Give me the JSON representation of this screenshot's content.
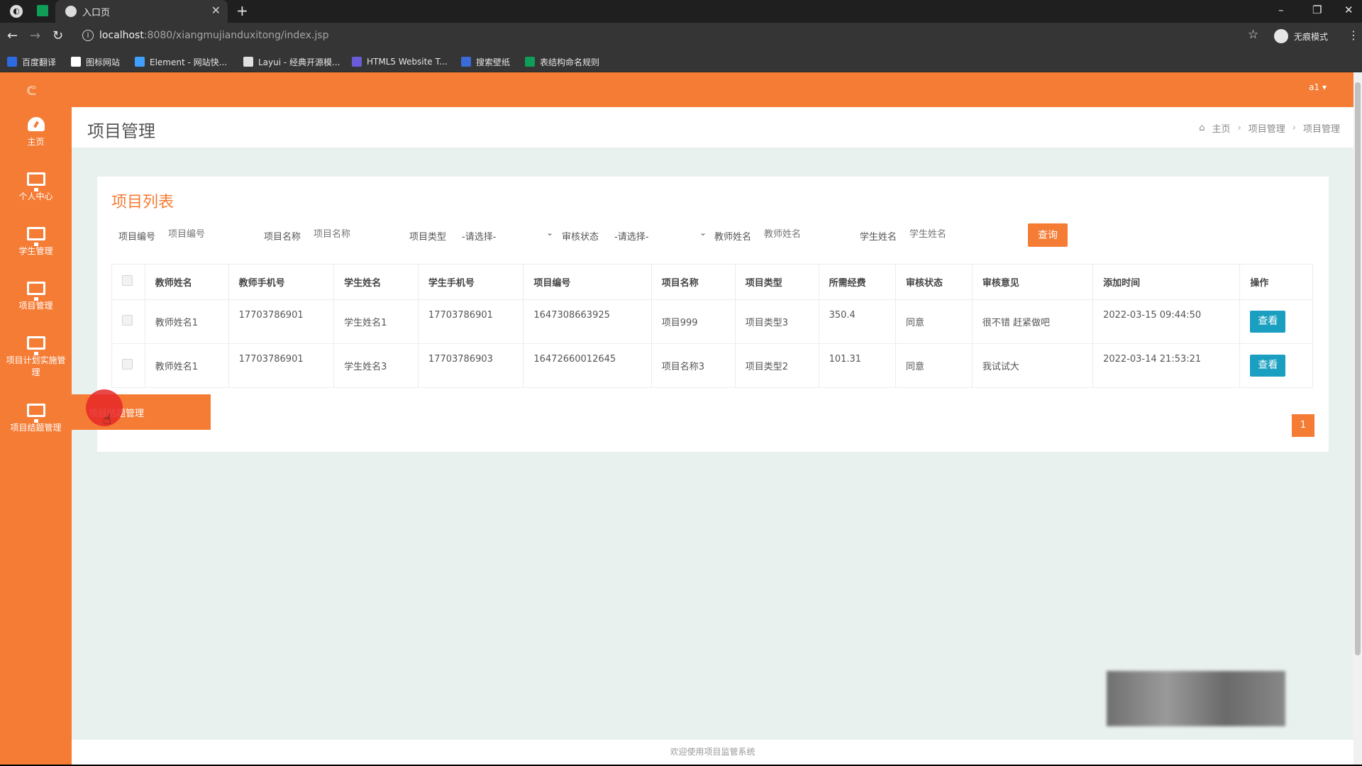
{
  "browser": {
    "tab_title": "入口页",
    "url_host": "localhost",
    "url_path": ":8080/xiangmujianduxitong/index.jsp",
    "incognito_label": "无痕模式",
    "bookmarks": [
      {
        "label": "百度翻译",
        "color": "#2d6ce0"
      },
      {
        "label": "图标网站",
        "color": "#ffffff"
      },
      {
        "label": "Element - 网站快...",
        "color": "#409eff"
      },
      {
        "label": "Layui - 经典开源模...",
        "color": "#e0e0e0"
      },
      {
        "label": "HTML5 Website T...",
        "color": "#6a5bd6"
      },
      {
        "label": "搜索壁纸",
        "color": "#3a6cd8"
      },
      {
        "label": "表结构命名规则",
        "color": "#0f9d58"
      }
    ]
  },
  "app": {
    "brand_color": "#f57c35",
    "user": "a1",
    "sidebar": [
      {
        "label": "主页",
        "icon": "dashboard-icon"
      },
      {
        "label": "个人中心",
        "icon": "monitor-icon"
      },
      {
        "label": "学生管理",
        "icon": "monitor-icon"
      },
      {
        "label": "项目管理",
        "icon": "monitor-icon"
      },
      {
        "label": "项目计划实施管理",
        "icon": "monitor-icon"
      },
      {
        "label": "项目结题管理",
        "icon": "monitor-icon"
      }
    ],
    "hover_popup": "项目结题管理",
    "page_title": "项目管理",
    "breadcrumb": [
      "主页",
      "项目管理",
      "项目管理"
    ],
    "card_title": "项目列表",
    "filters": {
      "project_no": {
        "label": "项目编号",
        "placeholder": "项目编号"
      },
      "project_name": {
        "label": "项目名称",
        "placeholder": "项目名称"
      },
      "project_type": {
        "label": "项目类型",
        "value": "-请选择-"
      },
      "audit_status": {
        "label": "审核状态",
        "value": "-请选择-"
      },
      "teacher_name": {
        "label": "教师姓名",
        "placeholder": "教师姓名"
      },
      "student_name": {
        "label": "学生姓名",
        "placeholder": "学生姓名"
      },
      "query_label": "查询"
    },
    "table": {
      "headers": [
        "教师姓名",
        "教师手机号",
        "学生姓名",
        "学生手机号",
        "项目编号",
        "项目名称",
        "项目类型",
        "所需经费",
        "审核状态",
        "审核意见",
        "添加时间",
        "操作"
      ],
      "rows": [
        [
          "教师姓名1",
          "17703786901",
          "学生姓名1",
          "17703786901",
          "1647308663925",
          "项目999",
          "项目类型3",
          "350.4",
          "同意",
          "很不错 赶紧做吧",
          "2022-03-15 09:44:50",
          "查看"
        ],
        [
          "教师姓名1",
          "17703786901",
          "学生姓名3",
          "17703786903",
          "16472660012645",
          "项目名称3",
          "项目类型2",
          "101.31",
          "同意",
          "我试试大",
          "2022-03-14 21:53:21",
          "查看"
        ]
      ]
    },
    "page_number": "1",
    "footer": "欢迎使用项目监管系统"
  }
}
